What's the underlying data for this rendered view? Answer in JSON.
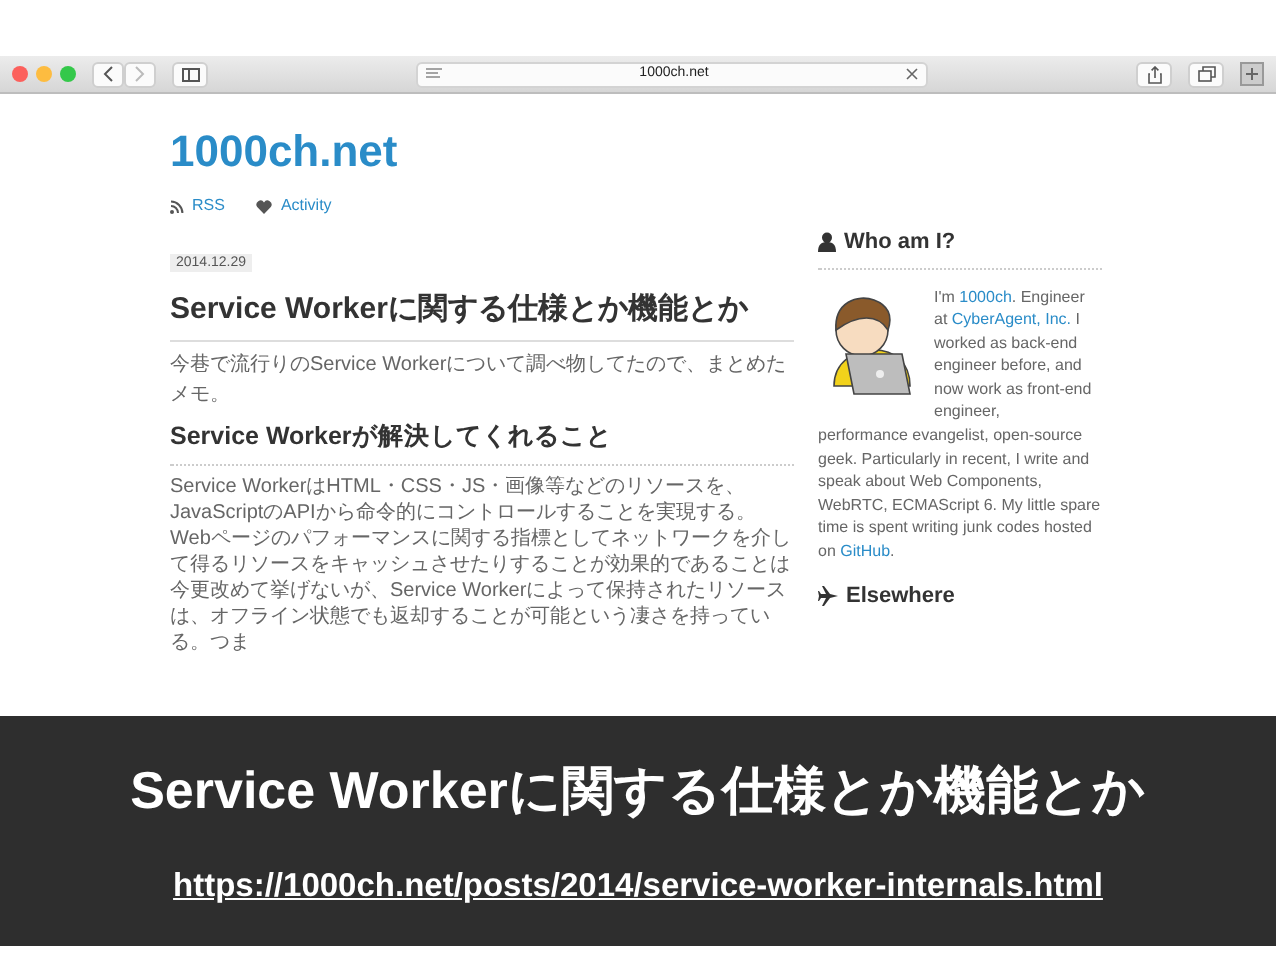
{
  "browser": {
    "url": "1000ch.net"
  },
  "blog": {
    "site_title": "1000ch.net",
    "nav": [
      {
        "kind": "rss",
        "label": "RSS"
      },
      {
        "kind": "heart",
        "label": "Activity"
      }
    ],
    "date": "2014.12.29",
    "post_title": "Service Workerに関する仕様とか機能とか",
    "intro": "今巷で流行りのService Workerについて調べ物してたので、まとめたメモ。",
    "section_heading": "Service Workerが解決してくれること",
    "paragraph": "Service WorkerはHTML・CSS・JS・画像等などのリソースを、JavaScriptのAPIから命令的にコントロールすることを実現する。Webページのパフォーマンスに関する指標としてネットワークを介して得るリソースをキャッシュさせたりすることが効果的であることは今更改めて挙げないが、Service Workerによって保持されたリソースは、オフライン状態でも返却することが可能という凄さを持っている。つま"
  },
  "sidebar": {
    "heading": "Who am I?",
    "bio": [
      [
        {
          "text": "I'm ",
          "link": false
        },
        {
          "text": "1000ch",
          "link": true
        },
        {
          "text": ". Engineer at ",
          "link": false
        },
        {
          "text": "CyberAgent, Inc.",
          "link": true
        },
        {
          "text": " I worked as back-end engineer before, and now work as front-end engineer,",
          "link": false
        }
      ],
      [
        {
          "text": "performance evangelist, open-source geek. Particularly in recent, I write and speak about Web Components, WebRTC, ECMAScript 6. My little spare time is spent writing junk codes hosted on ",
          "link": false
        },
        {
          "text": "GitHub",
          "link": true
        },
        {
          "text": ".",
          "link": false
        }
      ]
    ],
    "elsewhere_heading": "Elsewhere"
  },
  "overlay": {
    "title": "Service Workerに関する仕様とか機能とか",
    "url": "https://1000ch.net/posts/2014/service-worker-internals.html"
  }
}
